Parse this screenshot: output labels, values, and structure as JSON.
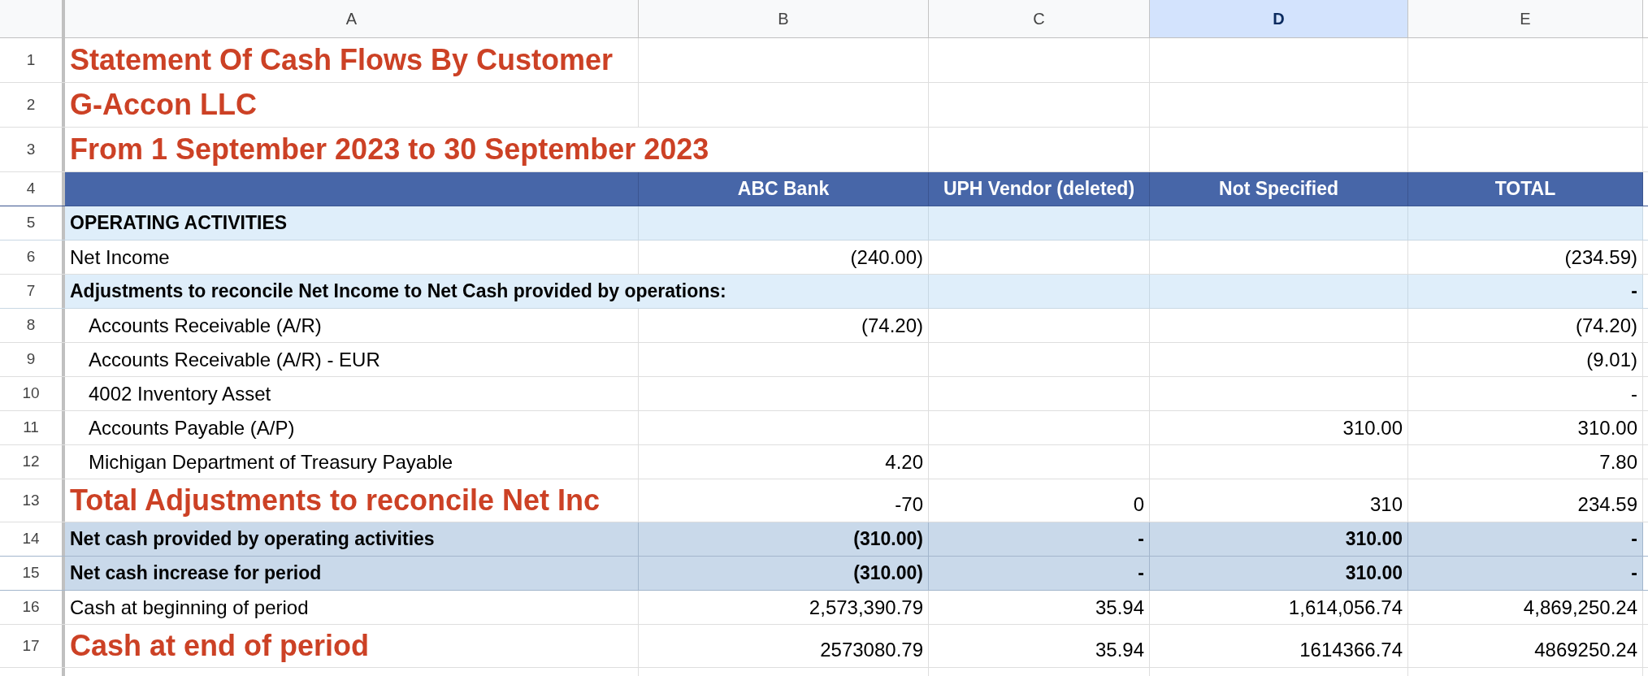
{
  "columns": [
    {
      "label": "A",
      "selected": false
    },
    {
      "label": "B",
      "selected": false
    },
    {
      "label": "C",
      "selected": false
    },
    {
      "label": "D",
      "selected": true
    },
    {
      "label": "E",
      "selected": false
    }
  ],
  "rows": [
    {
      "number": "1",
      "kind": "title",
      "label": "Statement Of Cash Flows By Customer"
    },
    {
      "number": "2",
      "kind": "title",
      "label": "G-Accon LLC"
    },
    {
      "number": "3",
      "kind": "title",
      "label": "From 1 September 2023 to 30 September 2023"
    },
    {
      "number": "4",
      "kind": "header",
      "B": "ABC Bank",
      "C": "UPH Vendor (deleted)",
      "D": "Not Specified",
      "E": "TOTAL"
    },
    {
      "number": "5",
      "kind": "section",
      "label": "OPERATING ACTIVITIES"
    },
    {
      "number": "6",
      "kind": "plain",
      "label": "Net Income",
      "B": "(240.00)",
      "E": "(234.59)"
    },
    {
      "number": "7",
      "kind": "section",
      "label": "Adjustments to reconcile Net Income to Net Cash provided by operations:",
      "E": "-"
    },
    {
      "number": "8",
      "kind": "item",
      "label": "Accounts Receivable (A/R)",
      "B": "(74.20)",
      "E": "(74.20)"
    },
    {
      "number": "9",
      "kind": "item",
      "label": "Accounts Receivable (A/R) - EUR",
      "E": "(9.01)"
    },
    {
      "number": "10",
      "kind": "item",
      "label": "4002 Inventory Asset",
      "E": "-"
    },
    {
      "number": "11",
      "kind": "item",
      "label": "Accounts Payable (A/P)",
      "D": "310.00",
      "E": "310.00"
    },
    {
      "number": "12",
      "kind": "item",
      "label": "Michigan Department of Treasury Payable",
      "B": "4.20",
      "E": "7.80"
    },
    {
      "number": "13",
      "kind": "big",
      "label": "Total Adjustments to reconcile Net Inc",
      "B": "-70",
      "C": "0",
      "D": "310",
      "E": "234.59"
    },
    {
      "number": "14",
      "kind": "summary",
      "label": "Net cash provided by operating activities",
      "B": "(310.00)",
      "C": "-",
      "D": "310.00",
      "E": "-"
    },
    {
      "number": "15",
      "kind": "summary",
      "label": "Net cash increase for period",
      "B": "(310.00)",
      "C": "-",
      "D": "310.00",
      "E": "-"
    },
    {
      "number": "16",
      "kind": "plain",
      "label": "Cash at beginning of period",
      "B": "2,573,390.79",
      "C": "35.94",
      "D": "1,614,056.74",
      "E": "4,869,250.24"
    },
    {
      "number": "17",
      "kind": "big",
      "label": "Cash at end of period",
      "B": "2573080.79",
      "C": "35.94",
      "D": "1614366.74",
      "E": "4869250.24"
    }
  ]
}
